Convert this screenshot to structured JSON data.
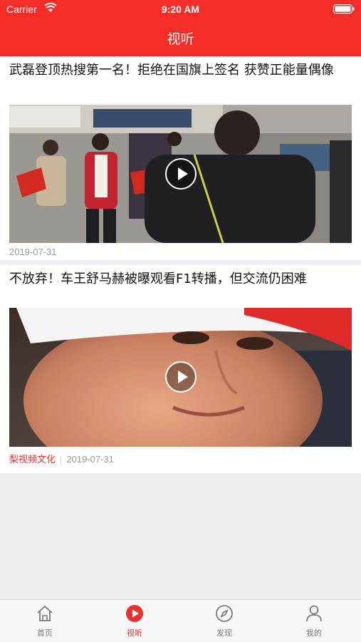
{
  "status_bar": {
    "carrier": "Carrier",
    "time": "9:20 AM"
  },
  "header": {
    "title": "视听"
  },
  "feed": [
    {
      "title": "武磊登顶热搜第一名！拒绝在国旗上签名  获赞正能量偶像",
      "source": "",
      "date": "2019-07-31",
      "thumbnail": "airport-crowd-photo"
    },
    {
      "title": "不放弃！车王舒马赫被曝观看F1转播，但交流仍困难",
      "source": "梨视频文化",
      "date": "2019-07-31",
      "thumbnail": "racing-driver-portrait"
    }
  ],
  "tabbar": {
    "active_color": "#e8322d",
    "items": [
      {
        "label": "首页",
        "icon": "home-icon"
      },
      {
        "label": "视听",
        "icon": "play-circle-icon",
        "active": true
      },
      {
        "label": "发现",
        "icon": "compass-icon"
      },
      {
        "label": "我的",
        "icon": "user-icon"
      }
    ]
  },
  "colors": {
    "brand": "#f52d28",
    "background": "#efeff4"
  }
}
